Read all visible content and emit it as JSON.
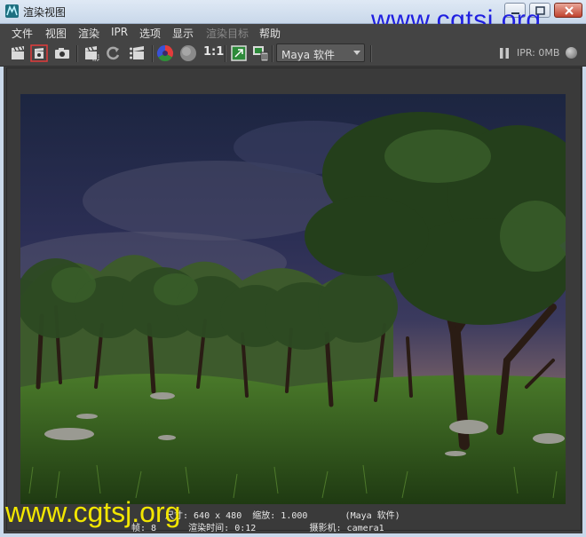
{
  "window": {
    "title": "渲染视图",
    "watermark_top": "www.cgtsj.org",
    "watermark_bottom": "www.cgtsj.org"
  },
  "menu": {
    "items": [
      {
        "label": "文件",
        "enabled": true
      },
      {
        "label": "视图",
        "enabled": true
      },
      {
        "label": "渲染",
        "enabled": true
      },
      {
        "label": "IPR",
        "enabled": true
      },
      {
        "label": "选项",
        "enabled": true
      },
      {
        "label": "显示",
        "enabled": true
      },
      {
        "label": "渲染目标",
        "enabled": false
      },
      {
        "label": "帮助",
        "enabled": true
      }
    ]
  },
  "toolbar": {
    "one_to_one": "1:1",
    "renderer": "Maya 软件",
    "ipr_status": "IPR: 0MB",
    "icons": [
      "clapboard-icon",
      "redo-render-icon",
      "snapshot-camera-icon",
      "render-region-icon",
      "refresh-icon",
      "ipr-render-icon",
      "rgb-channel-icon",
      "alpha-channel-icon",
      "keep-image-icon",
      "remove-image-icon"
    ]
  },
  "status": {
    "line1": "尺寸: 640 x 480  缩放: 1.000       (Maya 软件)",
    "line2": "帧: 8      渲染时间: 0:12          摄影机: camera1"
  }
}
